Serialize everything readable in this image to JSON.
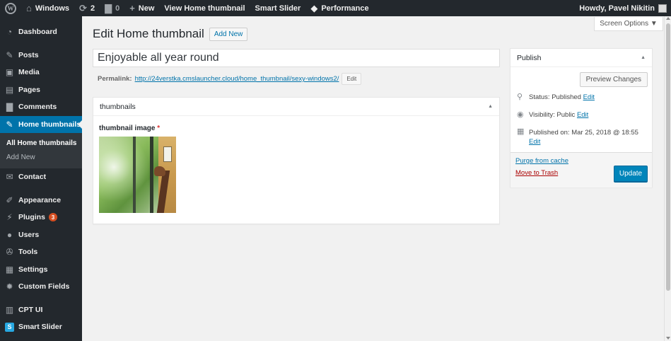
{
  "adminbar": {
    "site_name": "Windows",
    "updates_count": "2",
    "comments_count": "0",
    "new_label": "New",
    "view_label": "View Home thumbnail",
    "smart_slider_label": "Smart Slider",
    "performance_label": "Performance",
    "howdy": "Howdy, Pavel Nikitin"
  },
  "sidebar": {
    "items": [
      {
        "label": "Dashboard",
        "icon": "dashboard-icon"
      },
      {
        "label": "Posts",
        "icon": "pin-icon"
      },
      {
        "label": "Media",
        "icon": "media-icon"
      },
      {
        "label": "Pages",
        "icon": "page-icon"
      },
      {
        "label": "Comments",
        "icon": "comment-icon"
      },
      {
        "label": "Home thumbnails",
        "icon": "pin-icon"
      },
      {
        "label": "Contact",
        "icon": "mail-icon"
      },
      {
        "label": "Appearance",
        "icon": "brush-icon"
      },
      {
        "label": "Plugins",
        "icon": "plugin-icon",
        "badge": "3"
      },
      {
        "label": "Users",
        "icon": "user-icon"
      },
      {
        "label": "Tools",
        "icon": "wrench-icon"
      },
      {
        "label": "Settings",
        "icon": "settings-icon"
      },
      {
        "label": "Custom Fields",
        "icon": "gear-icon"
      },
      {
        "label": "CPT UI",
        "icon": "grid-icon"
      },
      {
        "label": "Smart Slider",
        "icon": "slider-icon"
      }
    ],
    "submenu": [
      "All Home thumbnails",
      "Add New"
    ]
  },
  "header": {
    "screen_options": "Screen Options ▼",
    "title": "Edit Home thumbnail",
    "add_new": "Add New"
  },
  "post": {
    "title_value": "Enjoyable all year round",
    "permalink_label": "Permalink:",
    "permalink_url": "http://24verstka.cmslauncher.cloud/home_thumbnail/sexy-windows2/",
    "permalink_edit": "Edit"
  },
  "thumbnails_box": {
    "heading": "thumbnails",
    "field_label": "thumbnail image",
    "required_mark": "*"
  },
  "publish_box": {
    "heading": "Publish",
    "preview": "Preview Changes",
    "status_label": "Status: Published",
    "status_edit": "Edit",
    "visibility_label": "Visibility: Public",
    "visibility_edit": "Edit",
    "published_label": "Published on: Mar 25, 2018 @ 18:55",
    "published_edit": "Edit",
    "purge": "Purge from cache",
    "trash": "Move to Trash",
    "update": "Update"
  },
  "colors": {
    "admin_dark": "#23282d",
    "accent_blue": "#0073aa",
    "button_blue": "#0085ba",
    "trash_red": "#a00"
  }
}
